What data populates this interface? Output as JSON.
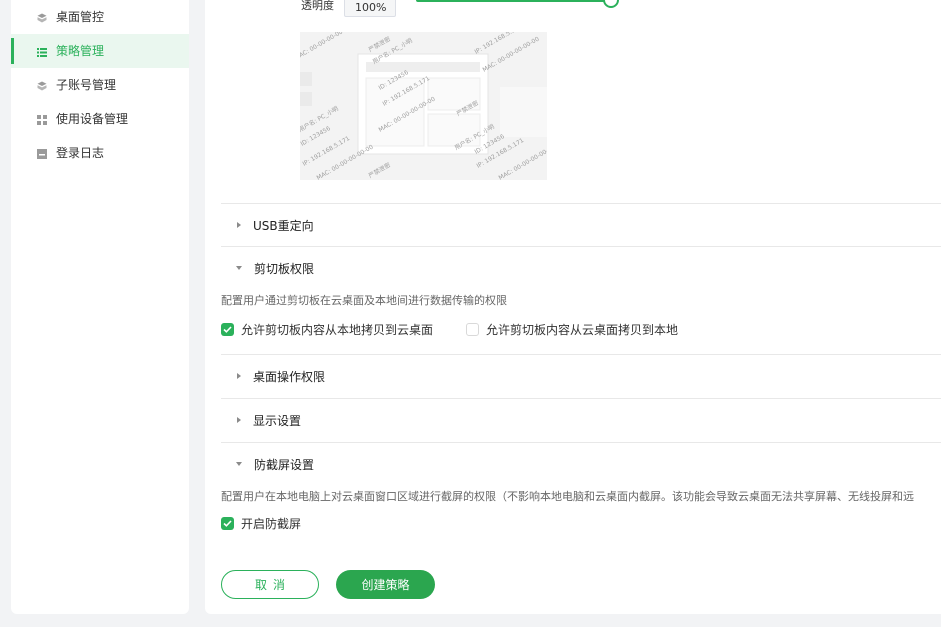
{
  "sidebar": {
    "items": [
      {
        "label": "桌面管控",
        "icon": "desktop-control-icon",
        "active": false
      },
      {
        "label": "策略管理",
        "icon": "list-icon",
        "active": true
      },
      {
        "label": "子账号管理",
        "icon": "sub-account-icon",
        "active": false
      },
      {
        "label": "使用设备管理",
        "icon": "grid-icon",
        "active": false
      },
      {
        "label": "登录日志",
        "icon": "log-icon",
        "active": false
      }
    ]
  },
  "watermark": {
    "opacity_label": "透明度",
    "opacity_value": "100%",
    "opacity_fraction": 1.0,
    "preview_texts": {
      "confidential": "严禁泄密",
      "user": "用户名: PC_小明",
      "id": "ID: 123456",
      "ip": "IP: 192.168.5.171",
      "mac": "MAC: 00-00-00-00-00"
    }
  },
  "sections": {
    "usb": {
      "title": "USB重定向",
      "expanded": false
    },
    "clipboard": {
      "title": "剪切板权限",
      "expanded": true,
      "description": "配置用户通过剪切板在云桌面及本地间进行数据传输的权限",
      "options": [
        {
          "label": "允许剪切板内容从本地拷贝到云桌面",
          "checked": true
        },
        {
          "label": "允许剪切板内容从云桌面拷贝到本地",
          "checked": false
        }
      ]
    },
    "desktop_ops": {
      "title": "桌面操作权限",
      "expanded": false
    },
    "display": {
      "title": "显示设置",
      "expanded": false
    },
    "anti_screenshot": {
      "title": "防截屏设置",
      "expanded": true,
      "description": "配置用户在本地电脑上对云桌面窗口区域进行截屏的权限（不影响本地电脑和云桌面内截屏。该功能会导致云桌面无法共享屏幕、无线投屏和远",
      "option": {
        "label": "开启防截屏",
        "checked": true
      }
    }
  },
  "actions": {
    "cancel_label": "取消",
    "create_label": "创建策略"
  },
  "colors": {
    "accent": "#2bb15b",
    "active_bg": "#eaf7ef",
    "page_bg": "#f2f3f5"
  }
}
